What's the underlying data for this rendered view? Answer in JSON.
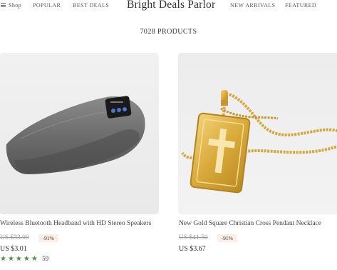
{
  "header": {
    "menu_label": "Shop",
    "nav_left": [
      "POPULAR",
      "BEST DEALS"
    ],
    "brand": "Bright Deals Parlor",
    "nav_right": [
      "NEW ARRIVALS",
      "FEATURED"
    ]
  },
  "catalog": {
    "count_label": "7028 PRODUCTS"
  },
  "products": [
    {
      "title": "Wireless Bluetooth Headband with HD Stereo Speakers",
      "old_price": "US $33.00",
      "discount": "-91%",
      "price": "US $3.01",
      "stars": "★★★★★",
      "rating_count": "59",
      "image": "headband-photo"
    },
    {
      "title": "New Gold Square Christian Cross Pendant Necklace",
      "old_price": "US $41.50",
      "discount": "-91%",
      "price": "US $3.67",
      "image": "necklace-photo"
    }
  ],
  "colors": {
    "star": "#5a8a52",
    "discount_bg": "#fbeee4",
    "image_bg": "#efefef"
  }
}
